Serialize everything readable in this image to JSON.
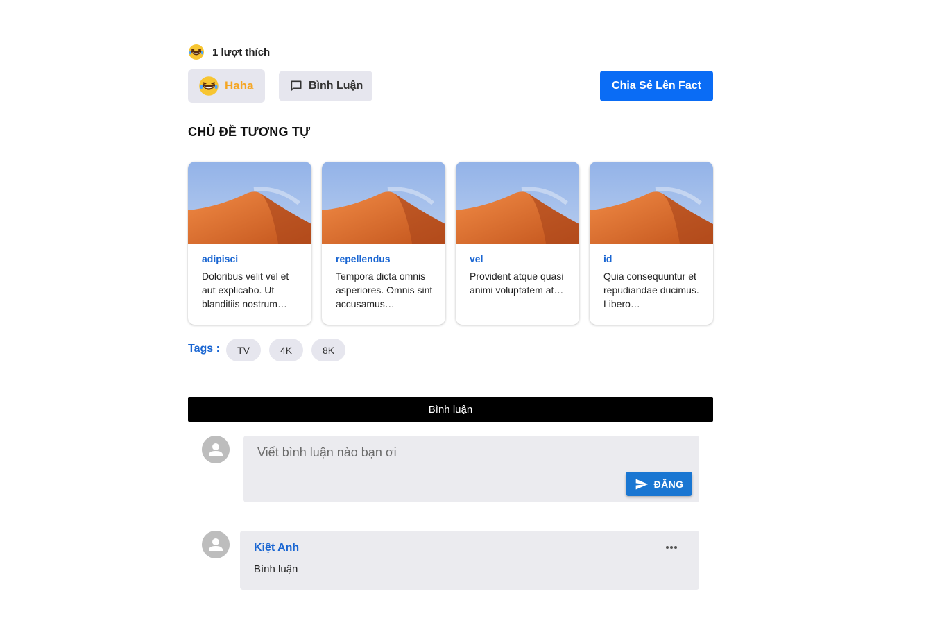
{
  "likes": {
    "count_text": "1 lượt thích",
    "reaction_icon": "laughing-emoji-icon"
  },
  "actions": {
    "haha_label": "Haha",
    "haha_color": "#f5a623",
    "comment_label": "Bình Luận",
    "share_label": "Chia Sẻ Lên Fact",
    "share_color": "#0a6cf5"
  },
  "related": {
    "title": "CHỦ ĐỀ TƯƠNG TỰ",
    "cards": [
      {
        "title": "adipisci",
        "description": "Doloribus velit vel et aut explicabo. Ut blanditiis nostrum…"
      },
      {
        "title": "repellendus",
        "description": "Tempora dicta omnis asperiores. Omnis sint accusamus…"
      },
      {
        "title": "vel",
        "description": "Provident atque quasi animi voluptatem at…"
      },
      {
        "title": "id",
        "description": "Quia consequuntur et repudiandae ducimus. Libero…"
      }
    ]
  },
  "tags": {
    "label": "Tags :",
    "items": [
      "TV",
      "4K",
      "8K"
    ]
  },
  "comments": {
    "header": "Bình luận",
    "composer_placeholder": "Viết bình luận nào bạn ơi",
    "post_label": "ĐĂNG",
    "list": [
      {
        "author": "Kiệt Anh",
        "text": "Bình luận"
      }
    ]
  }
}
